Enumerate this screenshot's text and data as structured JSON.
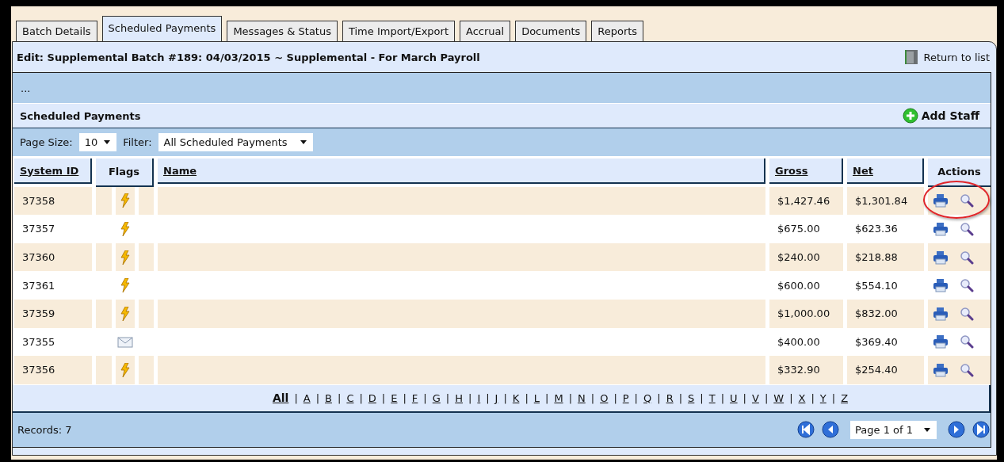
{
  "tabs": [
    {
      "label": "Batch Details",
      "selected": false
    },
    {
      "label": "Scheduled Payments",
      "selected": true
    },
    {
      "label": "Messages & Status",
      "selected": false
    },
    {
      "label": "Time Import/Export",
      "selected": false
    },
    {
      "label": "Accrual",
      "selected": false
    },
    {
      "label": "Documents",
      "selected": false
    },
    {
      "label": "Reports",
      "selected": false
    }
  ],
  "title": "Edit: Supplemental Batch #189: 04/03/2015 ~ Supplemental - For March Payroll",
  "return_link": "Return to list",
  "breadcrumb": "...",
  "section_title": "Scheduled Payments",
  "add_button": "Add Staff",
  "page_size": {
    "label": "Page Size:",
    "value": "10"
  },
  "filter": {
    "label": "Filter:",
    "value": "All Scheduled Payments"
  },
  "table": {
    "columns": [
      {
        "label": "System ID",
        "sortable": true
      },
      {
        "label": "Flags",
        "sortable": false
      },
      {
        "label": "Name",
        "sortable": true
      },
      {
        "label": "Gross",
        "sortable": true
      },
      {
        "label": "Net",
        "sortable": true
      },
      {
        "label": "Actions",
        "sortable": false
      }
    ],
    "rows": [
      {
        "system_id": "37358",
        "flag": {
          "kind": "lightning"
        },
        "gross": "$1,427.46",
        "net": "$1,301.84",
        "circled": true
      },
      {
        "system_id": "37357",
        "flag": {
          "kind": "lightning"
        },
        "gross": "$675.00",
        "net": "$623.36",
        "circled": false
      },
      {
        "system_id": "37360",
        "flag": {
          "kind": "lightning"
        },
        "gross": "$240.00",
        "net": "$218.88",
        "circled": false
      },
      {
        "system_id": "37361",
        "flag": {
          "kind": "lightning"
        },
        "gross": "$600.00",
        "net": "$554.10",
        "circled": false
      },
      {
        "system_id": "37359",
        "flag": {
          "kind": "lightning"
        },
        "gross": "$1,000.00",
        "net": "$832.00",
        "circled": false
      },
      {
        "system_id": "37355",
        "flag": {
          "kind": "envelope"
        },
        "gross": "$400.00",
        "net": "$369.40",
        "circled": false
      },
      {
        "system_id": "37356",
        "flag": {
          "kind": "lightning"
        },
        "gross": "$332.90",
        "net": "$254.40",
        "circled": false
      }
    ]
  },
  "alphabet": {
    "separator": "|",
    "letters": [
      {
        "label": "All",
        "selected": true
      },
      {
        "label": "A",
        "selected": false
      },
      {
        "label": "B",
        "selected": false
      },
      {
        "label": "C",
        "selected": false
      },
      {
        "label": "D",
        "selected": false
      },
      {
        "label": "E",
        "selected": false
      },
      {
        "label": "F",
        "selected": false
      },
      {
        "label": "G",
        "selected": false
      },
      {
        "label": "H",
        "selected": false
      },
      {
        "label": "I",
        "selected": false
      },
      {
        "label": "J",
        "selected": false
      },
      {
        "label": "K",
        "selected": false
      },
      {
        "label": "L",
        "selected": false
      },
      {
        "label": "M",
        "selected": false
      },
      {
        "label": "N",
        "selected": false
      },
      {
        "label": "O",
        "selected": false
      },
      {
        "label": "P",
        "selected": false
      },
      {
        "label": "Q",
        "selected": false
      },
      {
        "label": "R",
        "selected": false
      },
      {
        "label": "S",
        "selected": false
      },
      {
        "label": "T",
        "selected": false
      },
      {
        "label": "U",
        "selected": false
      },
      {
        "label": "V",
        "selected": false
      },
      {
        "label": "W",
        "selected": false
      },
      {
        "label": "X",
        "selected": false
      },
      {
        "label": "Y",
        "selected": false
      },
      {
        "label": "Z",
        "selected": false
      }
    ]
  },
  "records": "Records: 7",
  "pager": {
    "value": "Page 1 of 1"
  }
}
